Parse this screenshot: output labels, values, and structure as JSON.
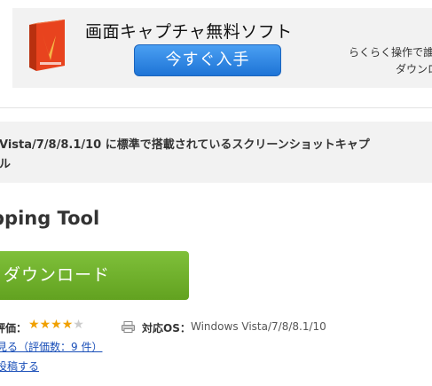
{
  "ad": {
    "title": "画面キャプチャ無料ソフト",
    "cta_label": "今すぐ入手",
    "tagline_1": "らくらく操作で誰",
    "tagline_2": "ダウンロ"
  },
  "description": {
    "line1": "Vista/7/8/8.1/10 に標準で搭載されているスクリーンショットキャプ",
    "line2": "ル"
  },
  "app": {
    "title": "pping Tool",
    "download_label": "ダウンロード"
  },
  "meta": {
    "rating_label": "評価：",
    "rating_value": 4,
    "rating_max": 5,
    "os_label": "対応OS：",
    "os_value": "Windows Vista/7/8/8.1/10",
    "reviews_link": "見る（評価数：9 件）",
    "post_link": "投稿する"
  },
  "colors": {
    "cta_blue": "#2a84e4",
    "download_green": "#6fb02c",
    "star": "#f0a000",
    "link": "#1a4fb8"
  }
}
